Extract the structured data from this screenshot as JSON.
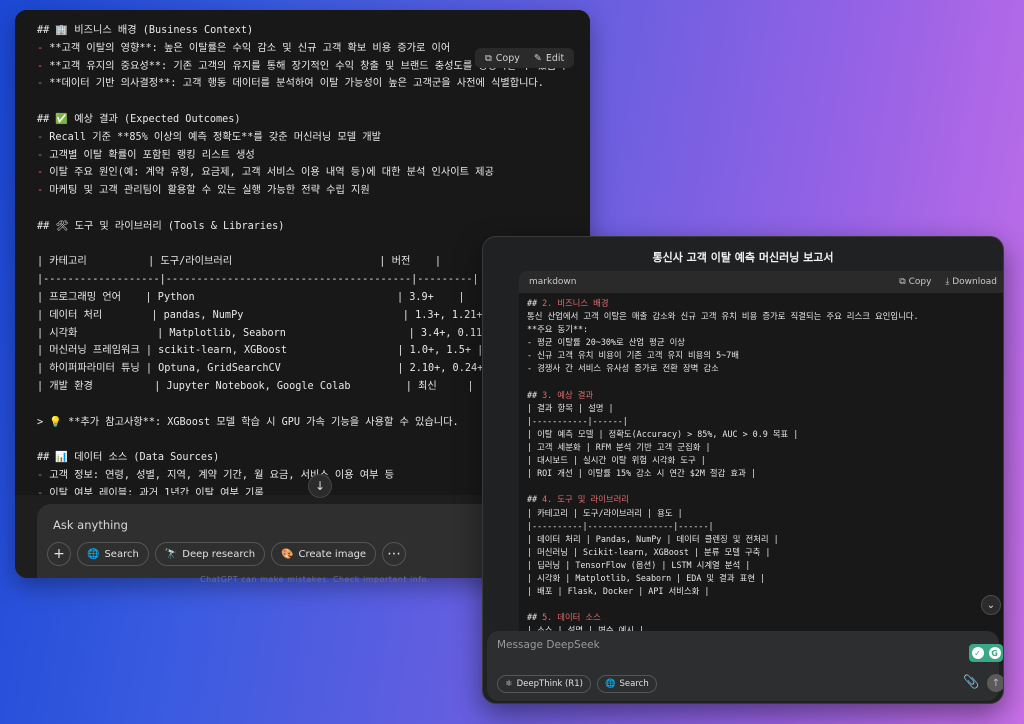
{
  "left": {
    "lines": [
      "## 🏢 비즈니스 배경 (Business Context)",
      "- **고객 이탈의 영향**: 높은 이탈률은 수익 감소 및 신규 고객 확보 비용 증가로 이어",
      "- **고객 유지의 중요성**: 기존 고객의 유지를 통해 장기적인 수익 창출 및 브랜드 충성도를 향상시킬 수 있습니",
      "- **데이터 기반 의사결정**: 고객 행동 데이터를 분석하여 이탈 가능성이 높은 고객군을 사전에 식별합니다.",
      "",
      "## ✅ 예상 결과 (Expected Outcomes)",
      "- Recall 기준 **85% 이상의 예측 정확도**를 갖춘 머신러닝 모델 개발",
      "- 고객별 이탈 확률이 포함된 랭킹 리스트 생성",
      "- 이탈 주요 원인(예: 계약 유형, 요금제, 고객 서비스 이용 내역 등)에 대한 분석 인사이트 제공",
      "- 마케팅 및 고객 관리팀이 활용할 수 있는 실행 가능한 전략 수립 지원",
      "",
      "## 🛠 도구 및 라이브러리 (Tools & Libraries)",
      "",
      "| 카테고리          | 도구/라이브러리                        | 버전    |",
      "|-------------------|----------------------------------------|---------|",
      "| 프로그래밍 언어    | Python                                 | 3.9+    |",
      "| 데이터 처리        | pandas, NumPy                          | 1.3+, 1.21+ |",
      "| 시각화             | Matplotlib, Seaborn                    | 3.4+, 0.11+ |",
      "| 머신러닝 프레임워크 | scikit-learn, XGBoost                  | 1.0+, 1.5+ |",
      "| 하이퍼파라미터 튜닝 | Optuna, GridSearchCV                   | 2.10+, 0.24+ |",
      "| 개발 환경          | Jupyter Notebook, Google Colab         | 최신     |",
      "",
      "> 💡 **추가 참고사항**: XGBoost 모델 학습 시 GPU 가속 기능을 사용할 수 있습니다.",
      "",
      "## 📊 데이터 소스 (Data Sources)",
      "- 고객 정보: 연령, 성별, 지역, 계약 기간, 월 요금, 서비스 이용 여부 등",
      "- 이탈 여부 레이블: 과거 1년간 이탈 여부 기록"
    ],
    "copy_label": "Copy",
    "edit_label": "Edit",
    "input_placeholder": "Ask anything",
    "tools": {
      "search": "Search",
      "deep_research": "Deep research",
      "create_image": "Create image"
    },
    "footer_faint": "ChatGPT can make mistakes. Check important info."
  },
  "right": {
    "title": "통신사 고객 이탈 예측 머신러닝 보고서",
    "code_lang": "markdown",
    "copy_label": "Copy",
    "download_label": "Download",
    "lines": [
      "## 2. 비즈니스 배경",
      "통신 산업에서 고객 이탈은 매출 감소와 신규 고객 유치 비용 증가로 직결되는 주요 리스크 요인입니다.",
      "**주요 동기**:",
      "- 평균 이탈률 20~30%로 산업 평균 이상",
      "- 신규 고객 유치 비용이 기존 고객 유지 비용의 5~7배",
      "- 경쟁사 간 서비스 유사성 증가로 전환 장벽 감소",
      "",
      "## 3. 예상 결과",
      "| 결과 항목 | 설명 |",
      "|-----------|------|",
      "| 이탈 예측 모델 | 정확도(Accuracy) > 85%, AUC > 0.9 목표 |",
      "| 고객 세분화 | RFM 분석 기반 고객 군집화 |",
      "| 대시보드 | 실시간 이탈 위험 시각화 도구 |",
      "| ROI 개선 | 이탈률 15% 감소 시 연간 $2M 절감 효과 |",
      "",
      "## 4. 도구 및 라이브러리",
      "| 카테고리 | 도구/라이브러리 | 용도 |",
      "|----------|-----------------|------|",
      "| 데이터 처리 | Pandas, NumPy | 데이터 클렌징 및 전처리 |",
      "| 머신러닝 | Scikit-learn, XGBoost | 분류 모델 구축 |",
      "| 딥러닝 | TensorFlow (옵션) | LSTM 시계열 분석 |",
      "| 시각화 | Matplotlib, Seaborn | EDA 및 결과 표현 |",
      "| 배포 | Flask, Docker | API 서비스화 |",
      "",
      "## 5. 데이터 소스",
      "| 소스 | 설명 | 변수 예시 |"
    ],
    "input_placeholder": "Message DeepSeek",
    "tools": {
      "deepthink": "DeepThink (R1)",
      "search": "Search"
    }
  }
}
